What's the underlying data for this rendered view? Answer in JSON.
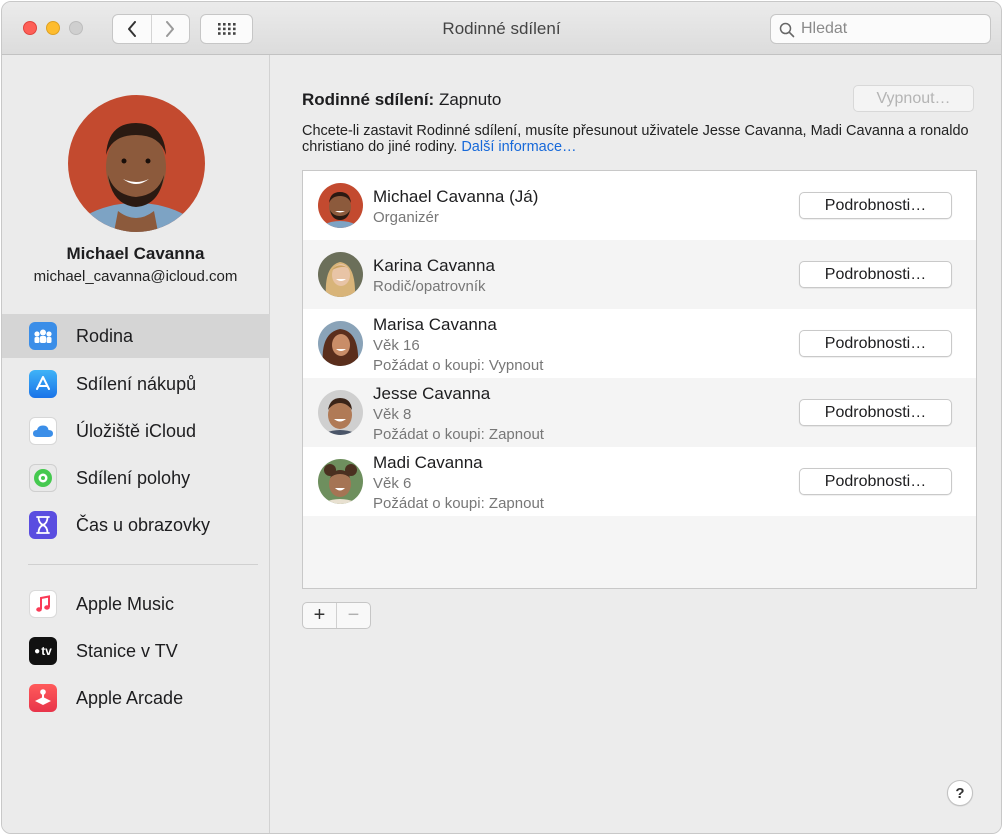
{
  "window": {
    "title": "Rodinné sdílení"
  },
  "toolbar": {
    "search_placeholder": "Hledat"
  },
  "sidebar": {
    "user_name": "Michael Cavanna",
    "user_email": "michael_cavanna@icloud.com",
    "items": [
      {
        "label": "Rodina",
        "icon": "family-icon",
        "selected": true
      },
      {
        "label": "Sdílení nákupů",
        "icon": "app-store-icon",
        "selected": false
      },
      {
        "label": "Úložiště iCloud",
        "icon": "icloud-icon",
        "selected": false
      },
      {
        "label": "Sdílení polohy",
        "icon": "find-my-icon",
        "selected": false
      },
      {
        "label": "Čas u obrazovky",
        "icon": "hourglass-icon",
        "selected": false
      }
    ],
    "services": [
      {
        "label": "Apple Music",
        "icon": "music-note-icon"
      },
      {
        "label": "Stanice v TV",
        "icon": "apple-tv-icon",
        "badge": "tv"
      },
      {
        "label": "Apple Arcade",
        "icon": "arcade-icon"
      }
    ]
  },
  "main": {
    "status_label": "Rodinné sdílení:",
    "status_value": "Zapnuto",
    "turn_off_label": "Vypnout…",
    "note_text": "Chcete-li zastavit Rodinné sdílení, musíte přesunout uživatele Jesse Cavanna, Madi Cavanna a ronaldo christiano do jiné rodiny.",
    "more_info_label": "Další informace…",
    "details_label": "Podrobnosti…",
    "members": [
      {
        "name": "Michael Cavanna (Já)",
        "lines": [
          "Organizér"
        ]
      },
      {
        "name": "Karina Cavanna",
        "lines": [
          "Rodič/opatrovník"
        ]
      },
      {
        "name": "Marisa Cavanna",
        "lines": [
          "Věk 16",
          "Požádat o koupi: Vypnout"
        ]
      },
      {
        "name": "Jesse Cavanna",
        "lines": [
          "Věk 8",
          "Požádat o koupi: Zapnout"
        ]
      },
      {
        "name": "Madi Cavanna",
        "lines": [
          "Věk 6",
          "Požádat o koupi: Zapnout"
        ]
      }
    ],
    "add_label": "+",
    "remove_label": "−",
    "help_label": "?"
  },
  "colors": {
    "link": "#1769d9",
    "selected_row": "#d5d5d5",
    "close": "#fe5f57",
    "minimize": "#febc2e",
    "zoom_inactive": "#cfcfcf"
  }
}
